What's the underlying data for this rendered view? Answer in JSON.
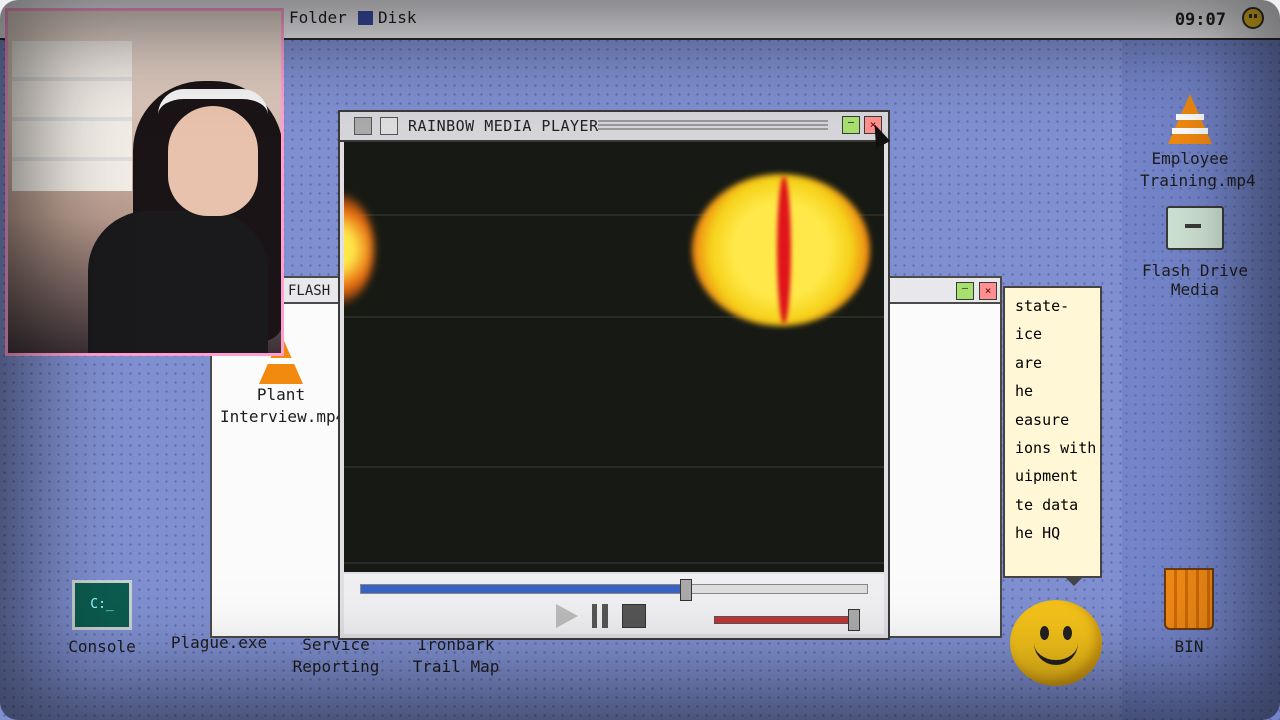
{
  "menubar": {
    "items": [
      "Folder",
      "Disk"
    ],
    "clock": "09:07",
    "status_icon": "smiley-icon"
  },
  "desktop_icons": {
    "employee_training": {
      "label1": "Employee",
      "label2": "Training.mp4",
      "icon": "traffic-cone-icon"
    },
    "flash_drive": {
      "label1": "Flash Drive",
      "label2": "Media",
      "icon": "folder-icon"
    },
    "plant_interview": {
      "label1": "Plant",
      "label2": "Interview.mp4",
      "icon": "traffic-cone-icon"
    },
    "console": {
      "label": "Console",
      "icon": "terminal-icon"
    },
    "plague": {
      "label": "Plague.exe"
    },
    "service_reporting": {
      "label1": "Service",
      "label2": "Reporting"
    },
    "ironbark": {
      "label1": "Ironbark",
      "label2": "Trail Map"
    },
    "bin": {
      "label": "BIN",
      "icon": "trash-bin-icon"
    }
  },
  "flash_window": {
    "title": "FLASH"
  },
  "note": {
    "lines": [
      "state-",
      "ice",
      "are",
      "he",
      "easure",
      "ions with",
      "uipment",
      "te data",
      "he HQ"
    ]
  },
  "player": {
    "title": "RAINBOW MEDIA PLAYER",
    "seek_progress": 0.64,
    "volume": 1.0,
    "accent_seek": "#3a64c4",
    "accent_volume": "#c23434"
  }
}
